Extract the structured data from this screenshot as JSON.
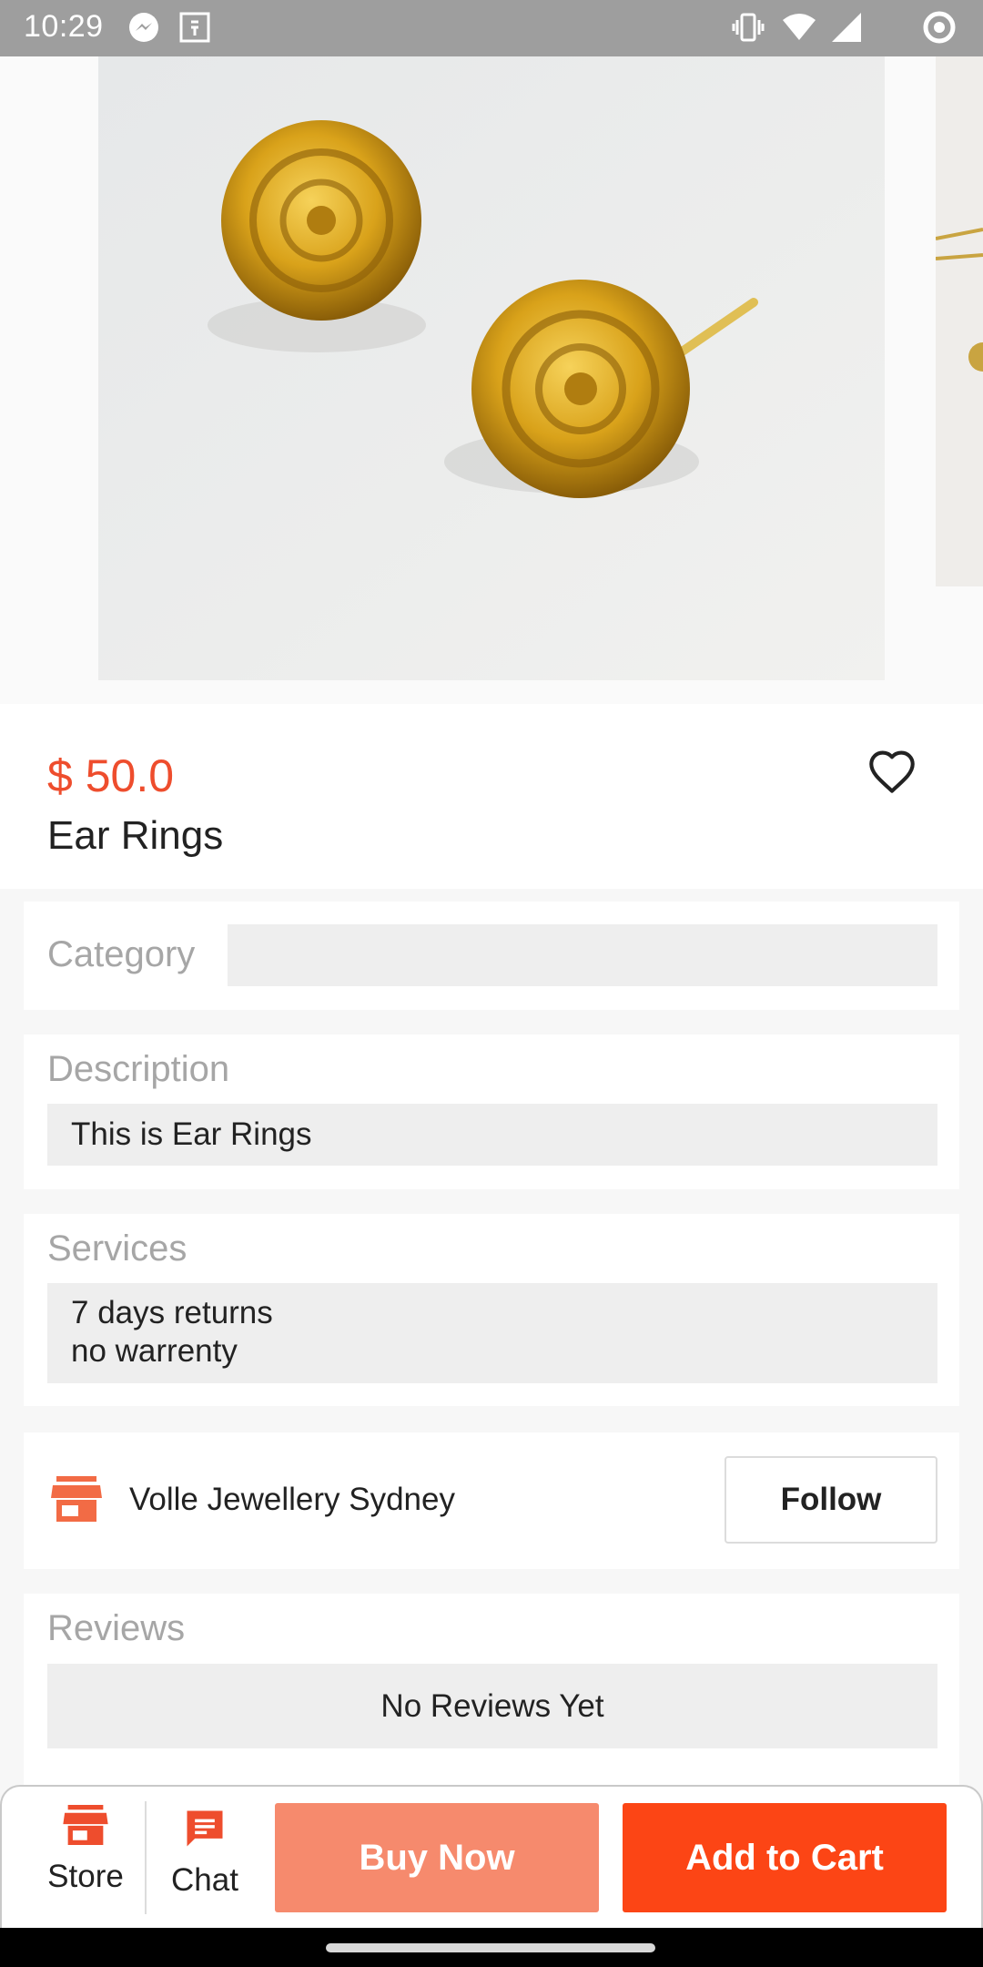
{
  "status_bar": {
    "time": "10:29"
  },
  "product": {
    "price": "$ 50.0",
    "name": "Ear Rings"
  },
  "category": {
    "title": "Category",
    "value": ""
  },
  "description": {
    "title": "Description",
    "text": "This is Ear Rings"
  },
  "services": {
    "title": "Services",
    "line1": "7 days returns",
    "line2": "no warrenty"
  },
  "store": {
    "name": "Volle Jewellery Sydney",
    "follow_label": "Follow"
  },
  "reviews": {
    "title": "Reviews",
    "empty_text": "No Reviews Yet"
  },
  "bottom_nav": {
    "store_label": "Store",
    "chat_label": "Chat",
    "buy_now_label": "Buy Now",
    "add_to_cart_label": "Add to Cart"
  },
  "icons": {
    "messenger": "messenger-icon",
    "notification": "e-icon",
    "vibrate": "vibrate-icon",
    "wifi": "wifi-icon",
    "signal": "signal-icon",
    "sync": "sync-icon",
    "favorite": "heart-icon",
    "store": "store-icon",
    "chat": "chat-icon"
  },
  "colors": {
    "accent": "#ee4d2d",
    "buy_now": "#f68a6d",
    "add_to_cart": "#fc4515",
    "status_bar": "#9e9e9e"
  }
}
